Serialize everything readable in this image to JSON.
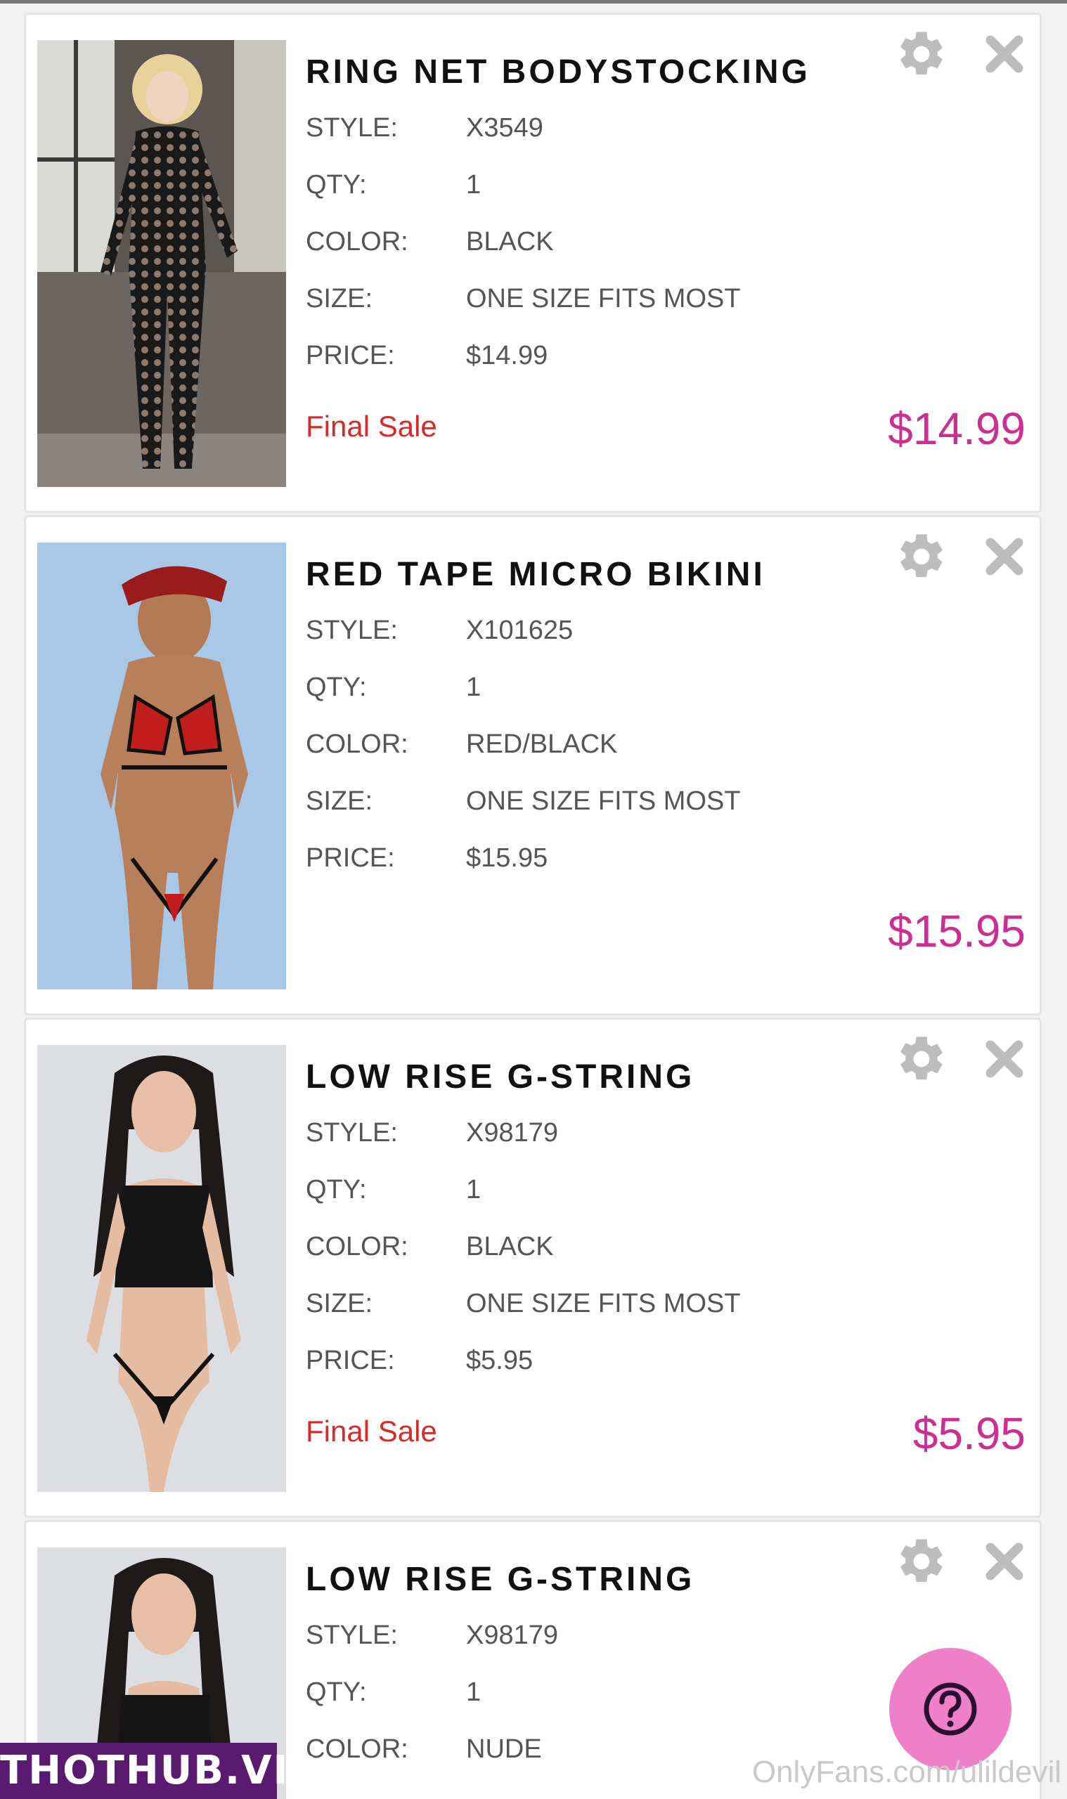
{
  "items": [
    {
      "name": "RING NET BODYSTOCKING",
      "image_alt": "Ring net bodystocking product photo",
      "details": [
        {
          "label": "STYLE:",
          "value": "X3549"
        },
        {
          "label": "QTY:",
          "value": "1"
        },
        {
          "label": "COLOR:",
          "value": "BLACK"
        },
        {
          "label": "SIZE:",
          "value": "ONE SIZE FITS MOST"
        },
        {
          "label": "PRICE:",
          "value": "$14.99"
        }
      ],
      "final_sale": "Final Sale",
      "total": "$14.99"
    },
    {
      "name": "RED TAPE MICRO BIKINI",
      "image_alt": "Red tape micro bikini product photo",
      "details": [
        {
          "label": "STYLE:",
          "value": "X101625"
        },
        {
          "label": "QTY:",
          "value": "1"
        },
        {
          "label": "COLOR:",
          "value": "RED/BLACK"
        },
        {
          "label": "SIZE:",
          "value": "ONE SIZE FITS MOST"
        },
        {
          "label": "PRICE:",
          "value": "$15.95"
        }
      ],
      "final_sale": "",
      "total": "$15.95"
    },
    {
      "name": "LOW RISE G-STRING",
      "image_alt": "Low rise g-string black product photo",
      "details": [
        {
          "label": "STYLE:",
          "value": "X98179"
        },
        {
          "label": "QTY:",
          "value": "1"
        },
        {
          "label": "COLOR:",
          "value": "BLACK"
        },
        {
          "label": "SIZE:",
          "value": "ONE SIZE FITS MOST"
        },
        {
          "label": "PRICE:",
          "value": "$5.95"
        }
      ],
      "final_sale": "Final Sale",
      "total": "$5.95"
    },
    {
      "name": "LOW RISE G-STRING",
      "image_alt": "Low rise g-string nude product photo",
      "details": [
        {
          "label": "STYLE:",
          "value": "X98179"
        },
        {
          "label": "QTY:",
          "value": "1"
        },
        {
          "label": "COLOR:",
          "value": "NUDE"
        }
      ],
      "final_sale": "",
      "total": ""
    }
  ],
  "help_button": {
    "label": "?"
  },
  "watermarks": {
    "left": "THOTHUB.VIP",
    "right": "OnlyFans.com/ulildevil"
  },
  "colors": {
    "price_pink": "#cc2e92",
    "final_sale_red": "#d42b2b",
    "help_button_pink": "#ee7fc8",
    "label_gray": "#555555",
    "title_black": "#111111"
  },
  "icons": {
    "settings": "gear-icon",
    "remove": "close-icon",
    "help": "question-icon"
  }
}
